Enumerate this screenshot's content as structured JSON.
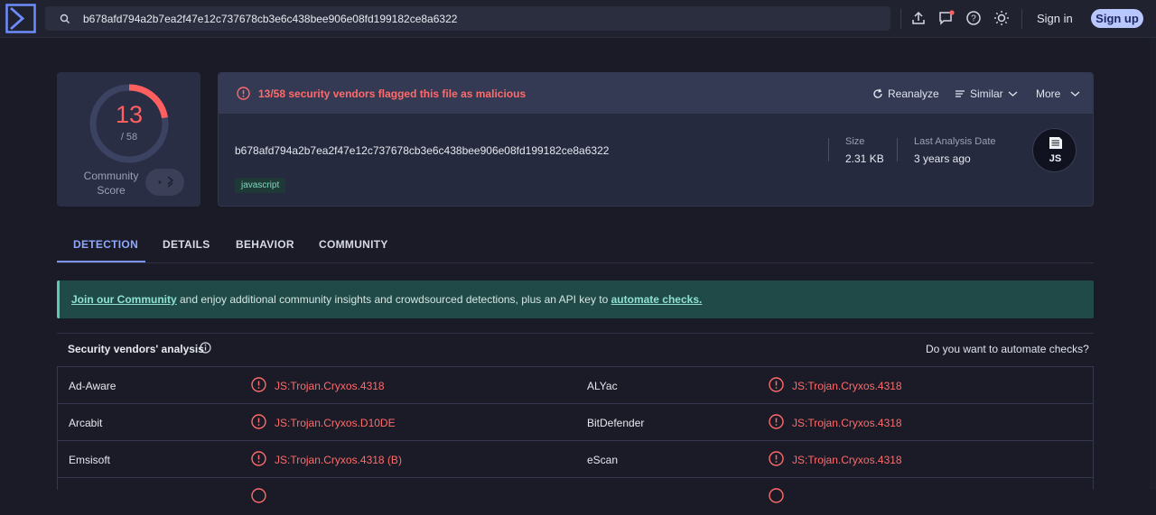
{
  "header": {
    "search_value": "b678afd794a2b7ea2f47e12c737678cb3e6c438bee906e08fd199182ce8a6322",
    "signin_label": "Sign in",
    "signup_label": "Sign up"
  },
  "score": {
    "detections": "13",
    "total": "/ 58",
    "community_label": "Community Score",
    "fraction_flagged": 0.224
  },
  "file": {
    "alert_text": "13/58 security vendors flagged this file as malicious",
    "reanalyze_label": "Reanalyze",
    "similar_label": "Similar",
    "more_label": "More",
    "hash": "b678afd794a2b7ea2f47e12c737678cb3e6c438bee906e08fd199182ce8a6322",
    "tag": "javascript",
    "size_label": "Size",
    "size_value": "2.31 KB",
    "date_label": "Last Analysis Date",
    "date_value": "3 years ago",
    "type_badge": "JS"
  },
  "tabs": [
    {
      "label": "DETECTION"
    },
    {
      "label": "DETAILS"
    },
    {
      "label": "BEHAVIOR"
    },
    {
      "label": "COMMUNITY"
    }
  ],
  "banner": {
    "link1": "Join our Community",
    "middle": " and enjoy additional community insights and crowdsourced detections, plus an API key to ",
    "link2": "automate checks."
  },
  "vendors": {
    "title": "Security vendors' analysis",
    "automate_prompt": "Do you want to automate checks?",
    "rows": [
      {
        "left_vendor": "Ad-Aware",
        "left_result": "JS:Trojan.Cryxos.4318",
        "right_vendor": "ALYac",
        "right_result": "JS:Trojan.Cryxos.4318"
      },
      {
        "left_vendor": "Arcabit",
        "left_result": "JS:Trojan.Cryxos.D10DE",
        "right_vendor": "BitDefender",
        "right_result": "JS:Trojan.Cryxos.4318"
      },
      {
        "left_vendor": "Emsisoft",
        "left_result": "JS:Trojan.Cryxos.4318 (B)",
        "right_vendor": "eScan",
        "right_result": "JS:Trojan.Cryxos.4318"
      }
    ]
  },
  "colors": {
    "malicious": "#ff6b6b",
    "accent": "#8fa8ff",
    "banner": "#1f4a48"
  },
  "icons": [
    "logo-icon",
    "search-icon",
    "upload-icon",
    "chat-icon",
    "help-icon",
    "theme-icon",
    "alert-icon",
    "refresh-icon",
    "similar-icon",
    "chevron-down-icon",
    "js-file-icon",
    "info-icon",
    "warning-icon"
  ]
}
